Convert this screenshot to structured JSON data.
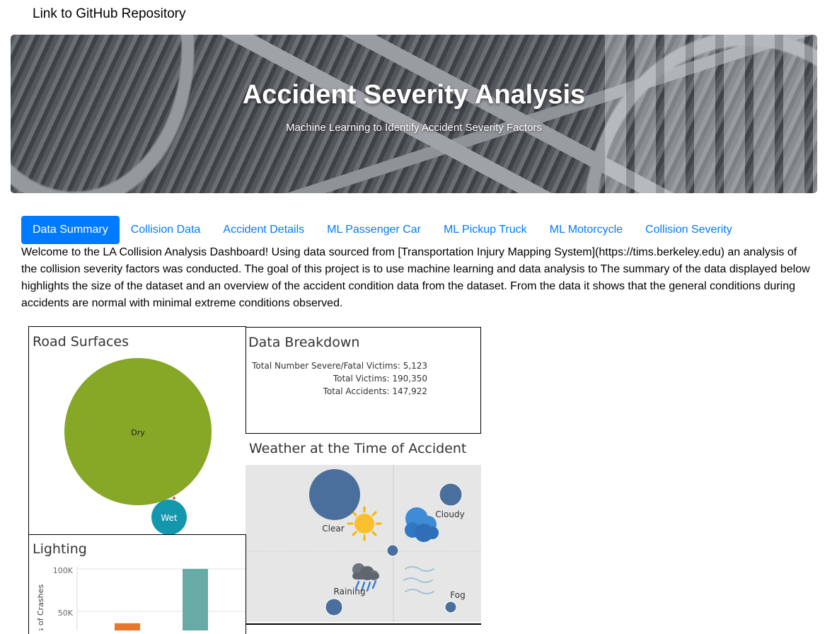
{
  "header": {
    "github_link": "Link to GitHub Repository"
  },
  "banner": {
    "title": "Accident Severity Analysis",
    "subtitle": "Machine Learning to Identify Accident Severity Factors"
  },
  "tabs": [
    {
      "label": "Data Summary",
      "active": true
    },
    {
      "label": "Collision Data",
      "active": false
    },
    {
      "label": "Accident Details",
      "active": false
    },
    {
      "label": "ML Passenger Car",
      "active": false
    },
    {
      "label": "ML Pickup Truck",
      "active": false
    },
    {
      "label": "ML Motorcycle",
      "active": false
    },
    {
      "label": "Collision Severity",
      "active": false
    }
  ],
  "intro_text": "Welcome to the LA Collision Analysis Dashboard! Using data sourced from [Transportation Injury Mapping System](https://tims.berkeley.edu) an analysis of the collision severity factors was conducted. The goal of this project is to use machine learning and data analysis to The summary of the data displayed below highlights the size of the dataset and an overview of the accident condition data from the dataset. From the data it shows that the general conditions during accidents are normal with minimal extreme conditions observed.",
  "colors": {
    "accent": "#007bff",
    "dry": "#86a826",
    "wet": "#1497ad",
    "weather_bubble": "#4a6f9c",
    "bar_orange": "#e8772e",
    "bar_teal": "#68aaa5"
  },
  "panels": {
    "road_surfaces": {
      "title": "Road Surfaces"
    },
    "data_breakdown": {
      "title": "Data Breakdown",
      "stats": [
        "Total Number Severe/Fatal Victims: 5,123",
        "Total Victims: 190,350",
        "Total Accidents: 147,922"
      ]
    },
    "weather": {
      "title": "Weather at the Time of Accident",
      "icons": [
        "sun-icon",
        "cloud-icon",
        "rain-cloud-icon",
        "fog-icon"
      ]
    },
    "lighting": {
      "title": "Lighting"
    }
  },
  "chart_data": [
    {
      "type": "bubble",
      "title": "Road Surfaces",
      "categories": [
        "Dry",
        "Wet"
      ],
      "values": [
        0.91,
        0.075
      ],
      "labels": [
        "Dry",
        "Wet"
      ]
    },
    {
      "type": "bubble",
      "title": "Weather at the Time of Accident",
      "categories": [
        "Clear",
        "Cloudy",
        "Raining",
        "Fog"
      ],
      "values": [
        1.0,
        0.2,
        0.11,
        0.05
      ],
      "labels": [
        "Clear",
        "Cloudy",
        "Raining",
        "Fog"
      ]
    },
    {
      "type": "bar",
      "title": "Lighting",
      "ylabel": "Counts of Crashes",
      "yticks": [
        "100K",
        "50K"
      ],
      "ylim": [
        0,
        100000
      ],
      "values": [
        36000,
        100000
      ]
    }
  ]
}
